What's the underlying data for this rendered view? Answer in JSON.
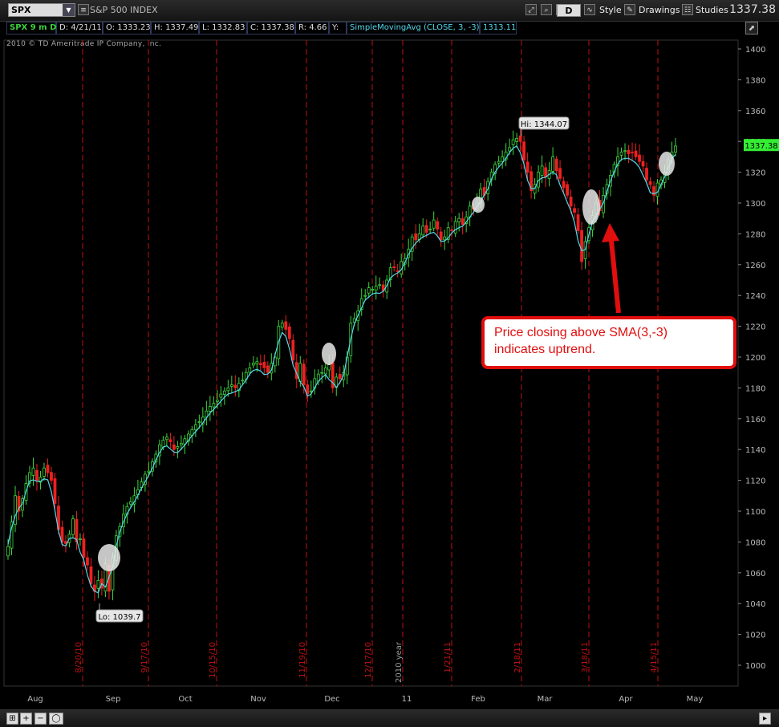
{
  "toolbar": {
    "symbol": "SPX",
    "index_name": "S&P 500 INDEX",
    "aggregation_label": "D",
    "style_label": "Style",
    "drawings_label": "Drawings",
    "studies_label": "Studies",
    "last_price": "1337.38"
  },
  "info": {
    "chart_label": "SPX 9 m D",
    "date": "D: 4/21/11",
    "open": "O: 1333.23",
    "high": "H: 1337.49",
    "low": "L: 1332.83",
    "close": "C: 1337.38",
    "range": "R: 4.66",
    "y_label": "Y:",
    "study_label": "SimpleMovingAvg (CLOSE, 3, -3)",
    "study_value": "1313.11"
  },
  "copyright": "2010 © TD Ameritrade IP Company, Inc.",
  "callout": {
    "line1": "Price closing above SMA(3,-3)",
    "line2": "indicates uptrend."
  },
  "colors": {
    "up": "#3cd83c",
    "down": "#ee2020",
    "sma": "#54d8ec",
    "divider": "#c01010",
    "grid": "#3a3a3a",
    "axis_text": "#bbbbbb",
    "price_tag": "#33ee33",
    "annotation": "#e10e0e"
  },
  "chart_data": {
    "type": "candlestick",
    "ylim": [
      990,
      1410
    ],
    "y_ticks": [
      1000,
      1020,
      1040,
      1060,
      1080,
      1100,
      1120,
      1140,
      1160,
      1180,
      1200,
      1220,
      1240,
      1260,
      1280,
      1300,
      1320,
      1340,
      1360,
      1380,
      1400
    ],
    "x_month_labels": [
      "Aug",
      "Sep",
      "Oct",
      "Nov",
      "Dec",
      "11",
      "Feb",
      "Mar",
      "Apr",
      "May"
    ],
    "divider_dates": [
      "8/20/10",
      "9/17/10",
      "10/15/10",
      "11/19/10",
      "12/17/10",
      "2010 year",
      "1/21/11",
      "2/18/11",
      "3/18/11",
      "4/15/11"
    ],
    "hi_label": "Hi: 1344.07",
    "lo_label": "Lo: 1039.7",
    "last_price_tag": "1337.38",
    "closes": [
      1077,
      1093,
      1110,
      1100,
      1108,
      1118,
      1125,
      1128,
      1120,
      1122,
      1128,
      1125,
      1120,
      1105,
      1088,
      1080,
      1079,
      1085,
      1095,
      1080,
      1082,
      1070,
      1065,
      1053,
      1048,
      1055,
      1050,
      1066,
      1048,
      1070,
      1084,
      1090,
      1098,
      1103,
      1106,
      1110,
      1114,
      1119,
      1124,
      1126,
      1132,
      1137,
      1143,
      1146,
      1148,
      1145,
      1140,
      1142,
      1144,
      1147,
      1150,
      1153,
      1156,
      1158,
      1161,
      1165,
      1168,
      1170,
      1172,
      1176,
      1178,
      1180,
      1182,
      1180,
      1183,
      1185,
      1190,
      1193,
      1196,
      1197,
      1195,
      1193,
      1190,
      1196,
      1200,
      1220,
      1222,
      1218,
      1212,
      1198,
      1186,
      1196,
      1182,
      1176,
      1178,
      1186,
      1189,
      1190,
      1193,
      1195,
      1180,
      1187,
      1186,
      1190,
      1200,
      1222,
      1225,
      1230,
      1238,
      1240,
      1245,
      1244,
      1246,
      1247,
      1243,
      1250,
      1258,
      1258,
      1256,
      1262,
      1264,
      1270,
      1278,
      1276,
      1280,
      1285,
      1281,
      1283,
      1289,
      1283,
      1276,
      1278,
      1284,
      1282,
      1288,
      1290,
      1286,
      1291,
      1298,
      1296,
      1300,
      1309,
      1305,
      1314,
      1320,
      1325,
      1327,
      1330,
      1333,
      1336,
      1341,
      1342,
      1340,
      1328,
      1320,
      1308,
      1312,
      1320,
      1324,
      1317,
      1321,
      1330,
      1321,
      1316,
      1310,
      1305,
      1298,
      1294,
      1282,
      1262,
      1275,
      1284,
      1292,
      1300,
      1295,
      1305,
      1312,
      1318,
      1325,
      1330,
      1333,
      1334,
      1332,
      1333,
      1330,
      1327,
      1324,
      1315,
      1312,
      1305,
      1313,
      1315,
      1320,
      1328,
      1333,
      1337
    ]
  }
}
